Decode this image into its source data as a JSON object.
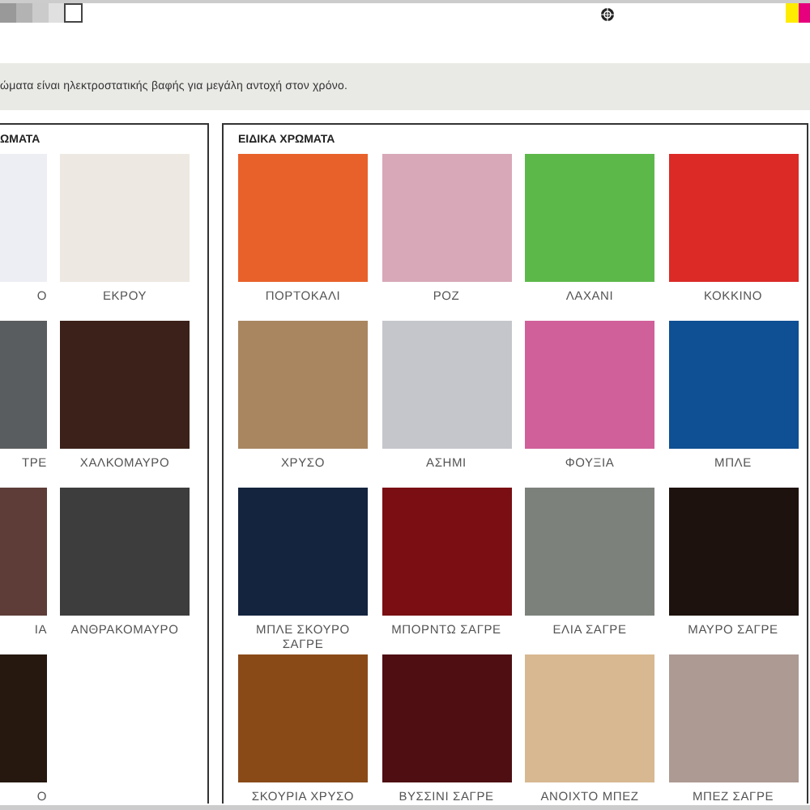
{
  "note": "ώματα είναι ηλεκτροστατικής βαφής για μεγάλη αντοχή στον χρόνο.",
  "panels": [
    {
      "title": "ΩΜΑΤΑ",
      "kind": "cut",
      "swatches": [
        {
          "label": "Ο",
          "color": "#eceef4"
        },
        {
          "label": "ΕΚΡΟΥ",
          "color": "#ede8e1"
        },
        {
          "label": "ΤΡΕ",
          "color": "#5a5d60"
        },
        {
          "label": "ΧΑΛΚΟΜΑΥΡΟ",
          "color": "#3b2119"
        },
        {
          "label": "ΙΑ",
          "color": "#5e3c38"
        },
        {
          "label": "ΑΝΘΡΑΚΟΜΑΥΡΟ",
          "color": "#3d3d3e"
        },
        {
          "label": "Ο",
          "color": "#26180f"
        }
      ]
    },
    {
      "title": "ΕΙΔΙΚΑ ΧΡΩΜΑΤΑ",
      "kind": "full",
      "swatches": [
        {
          "label": "ΠΟΡΤΟΚΑΛΙ",
          "color": "#e8612a"
        },
        {
          "label": "ΡΟΖ",
          "color": "#d9a8b8"
        },
        {
          "label": "ΛΑΧΑΝΙ",
          "color": "#5db84a"
        },
        {
          "label": "ΚΟΚΚΙΝΟ",
          "color": "#dc2a27"
        },
        {
          "label": "ΧΡΥΣΟ",
          "color": "#a98660"
        },
        {
          "label": "ΑΣΗΜΙ",
          "color": "#c4c6cb"
        },
        {
          "label": "ΦΟΥΞΙΑ",
          "color": "#d0609a"
        },
        {
          "label": "ΜΠΛΕ",
          "color": "#0f4f93"
        },
        {
          "label": "ΜΠΛΕ ΣΚΟΥΡΟ ΣΑΓΡΕ",
          "color": "#14243f"
        },
        {
          "label": "ΜΠΟΡΝΤΩ ΣΑΓΡΕ",
          "color": "#7a0e12"
        },
        {
          "label": "ΕΛΙΑ ΣΑΓΡΕ",
          "color": "#7d817b"
        },
        {
          "label": "ΜΑΥΡΟ ΣΑΓΡΕ",
          "color": "#1e120e"
        },
        {
          "label": "ΣΚΟΥΡΙΑ ΧΡΥΣΟ",
          "color": "#8a4a18"
        },
        {
          "label": "ΒΥΣΣΙΝΙ ΣΑΓΡΕ",
          "color": "#4e0e12"
        },
        {
          "label": "ΑΝΟΙΧΤΟ ΜΠΕΖ",
          "color": "#d8b890"
        },
        {
          "label": "ΜΠΕΖ ΣΑΓΡΕ",
          "color": "#ad9a92"
        }
      ]
    }
  ]
}
